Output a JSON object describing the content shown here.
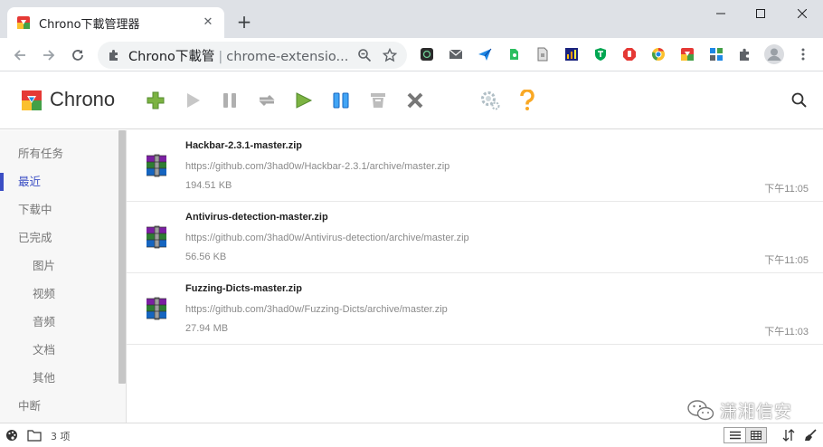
{
  "browser": {
    "tab_title": "Chrono下載管理器",
    "omnibox": {
      "title": "Chrono下載管",
      "separator": "|",
      "url": "chrome-extensio..."
    },
    "extensions": [
      "dark-square-icon",
      "mail-icon",
      "send-arrow-icon",
      "evernote-icon",
      "document-icon",
      "chart-icon",
      "shield-icon",
      "stop-hand-icon",
      "chrome-circle-icon",
      "chrono-icon",
      "grid-icon",
      "puzzle-icon",
      "avatar-icon",
      "more-icon"
    ]
  },
  "app": {
    "name": "Chrono",
    "toolbar": [
      "add-icon",
      "play-icon",
      "pause-icon",
      "refresh-icon",
      "start-all-icon",
      "pause-all-icon",
      "delete-icon",
      "clear-icon",
      "settings-icon",
      "help-icon"
    ]
  },
  "sidebar": {
    "items": [
      {
        "label": "所有任务",
        "level": "top"
      },
      {
        "label": "最近",
        "level": "top",
        "active": true
      },
      {
        "label": "下载中",
        "level": "top"
      },
      {
        "label": "已完成",
        "level": "top"
      },
      {
        "label": "图片",
        "level": "sub"
      },
      {
        "label": "视频",
        "level": "sub"
      },
      {
        "label": "音频",
        "level": "sub"
      },
      {
        "label": "文档",
        "level": "sub"
      },
      {
        "label": "其他",
        "level": "sub"
      },
      {
        "label": "中断",
        "level": "top"
      }
    ]
  },
  "downloads": [
    {
      "name": "Hackbar-2.3.1-master.zip",
      "url": "https://github.com/3had0w/Hackbar-2.3.1/archive/master.zip",
      "size": "194.51 KB",
      "time": "下午11:05"
    },
    {
      "name": "Antivirus-detection-master.zip",
      "url": "https://github.com/3had0w/Antivirus-detection/archive/master.zip",
      "size": "56.56 KB",
      "time": "下午11:05"
    },
    {
      "name": "Fuzzing-Dicts-master.zip",
      "url": "https://github.com/3had0w/Fuzzing-Dicts/archive/master.zip",
      "size": "27.94 MB",
      "time": "下午11:03"
    }
  ],
  "statusbar": {
    "count": "3 项"
  },
  "watermark": "潇湘信安",
  "colors": {
    "accent": "#3b4ec4",
    "tabstrip": "#dee1e6"
  }
}
